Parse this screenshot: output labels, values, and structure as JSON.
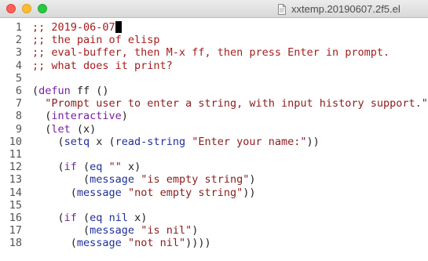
{
  "window": {
    "title": "xxtemp.20190607.2f5.el",
    "file_icon": "document-icon",
    "buttons": [
      {
        "name": "close",
        "color": "#ff5f57"
      },
      {
        "name": "minimize",
        "color": "#ffbd2e"
      },
      {
        "name": "maximize",
        "color": "#28c940"
      }
    ]
  },
  "colors": {
    "comment": "#a51d1d",
    "keyword": "#7a1fa2",
    "function": "#1f2f98",
    "string": "#8b1c1c",
    "default": "#222222",
    "line_number": "#555555"
  },
  "editor": {
    "lines": [
      {
        "number": "1",
        "tokens": [
          {
            "t": "comment",
            "v": ";; 2019-06-07"
          }
        ],
        "cursor": true
      },
      {
        "number": "2",
        "tokens": [
          {
            "t": "comment",
            "v": ";; the pain of elisp"
          }
        ]
      },
      {
        "number": "3",
        "tokens": [
          {
            "t": "comment",
            "v": ";; eval-buffer, then M-x ff, then press Enter in prompt."
          }
        ]
      },
      {
        "number": "4",
        "tokens": [
          {
            "t": "comment",
            "v": ";; what does it print?"
          }
        ]
      },
      {
        "number": "5",
        "tokens": []
      },
      {
        "number": "6",
        "tokens": [
          {
            "t": "paren",
            "v": "("
          },
          {
            "t": "kw",
            "v": "defun"
          },
          {
            "t": "plain",
            "v": " ff ()"
          }
        ]
      },
      {
        "number": "7",
        "tokens": [
          {
            "t": "plain",
            "v": "  "
          },
          {
            "t": "str",
            "v": "\"Prompt user to enter a string, with input history support.\""
          }
        ]
      },
      {
        "number": "8",
        "tokens": [
          {
            "t": "plain",
            "v": "  ("
          },
          {
            "t": "kw",
            "v": "interactive"
          },
          {
            "t": "plain",
            "v": ")"
          }
        ]
      },
      {
        "number": "9",
        "tokens": [
          {
            "t": "plain",
            "v": "  ("
          },
          {
            "t": "kw",
            "v": "let"
          },
          {
            "t": "plain",
            "v": " (x)"
          }
        ]
      },
      {
        "number": "10",
        "tokens": [
          {
            "t": "plain",
            "v": "    ("
          },
          {
            "t": "fn",
            "v": "setq"
          },
          {
            "t": "plain",
            "v": " x ("
          },
          {
            "t": "fn",
            "v": "read-string"
          },
          {
            "t": "plain",
            "v": " "
          },
          {
            "t": "str",
            "v": "\"Enter your name:\""
          },
          {
            "t": "plain",
            "v": "))"
          }
        ]
      },
      {
        "number": "11",
        "tokens": []
      },
      {
        "number": "12",
        "tokens": [
          {
            "t": "plain",
            "v": "    ("
          },
          {
            "t": "kw",
            "v": "if"
          },
          {
            "t": "plain",
            "v": " ("
          },
          {
            "t": "fn",
            "v": "eq"
          },
          {
            "t": "plain",
            "v": " "
          },
          {
            "t": "str",
            "v": "\"\""
          },
          {
            "t": "plain",
            "v": " x)"
          }
        ]
      },
      {
        "number": "13",
        "tokens": [
          {
            "t": "plain",
            "v": "        ("
          },
          {
            "t": "fn",
            "v": "message"
          },
          {
            "t": "plain",
            "v": " "
          },
          {
            "t": "str",
            "v": "\"is empty string\""
          },
          {
            "t": "plain",
            "v": ")"
          }
        ]
      },
      {
        "number": "14",
        "tokens": [
          {
            "t": "plain",
            "v": "      ("
          },
          {
            "t": "fn",
            "v": "message"
          },
          {
            "t": "plain",
            "v": " "
          },
          {
            "t": "str",
            "v": "\"not empty string\""
          },
          {
            "t": "plain",
            "v": "))"
          }
        ]
      },
      {
        "number": "15",
        "tokens": []
      },
      {
        "number": "16",
        "tokens": [
          {
            "t": "plain",
            "v": "    ("
          },
          {
            "t": "kw",
            "v": "if"
          },
          {
            "t": "plain",
            "v": " ("
          },
          {
            "t": "fn",
            "v": "eq"
          },
          {
            "t": "plain",
            "v": " "
          },
          {
            "t": "fn",
            "v": "nil"
          },
          {
            "t": "plain",
            "v": " x)"
          }
        ]
      },
      {
        "number": "17",
        "tokens": [
          {
            "t": "plain",
            "v": "        ("
          },
          {
            "t": "fn",
            "v": "message"
          },
          {
            "t": "plain",
            "v": " "
          },
          {
            "t": "str",
            "v": "\"is nil\""
          },
          {
            "t": "plain",
            "v": ")"
          }
        ]
      },
      {
        "number": "18",
        "tokens": [
          {
            "t": "plain",
            "v": "      ("
          },
          {
            "t": "fn",
            "v": "message"
          },
          {
            "t": "plain",
            "v": " "
          },
          {
            "t": "str",
            "v": "\"not nil\""
          },
          {
            "t": "plain",
            "v": "))))"
          }
        ]
      }
    ]
  }
}
